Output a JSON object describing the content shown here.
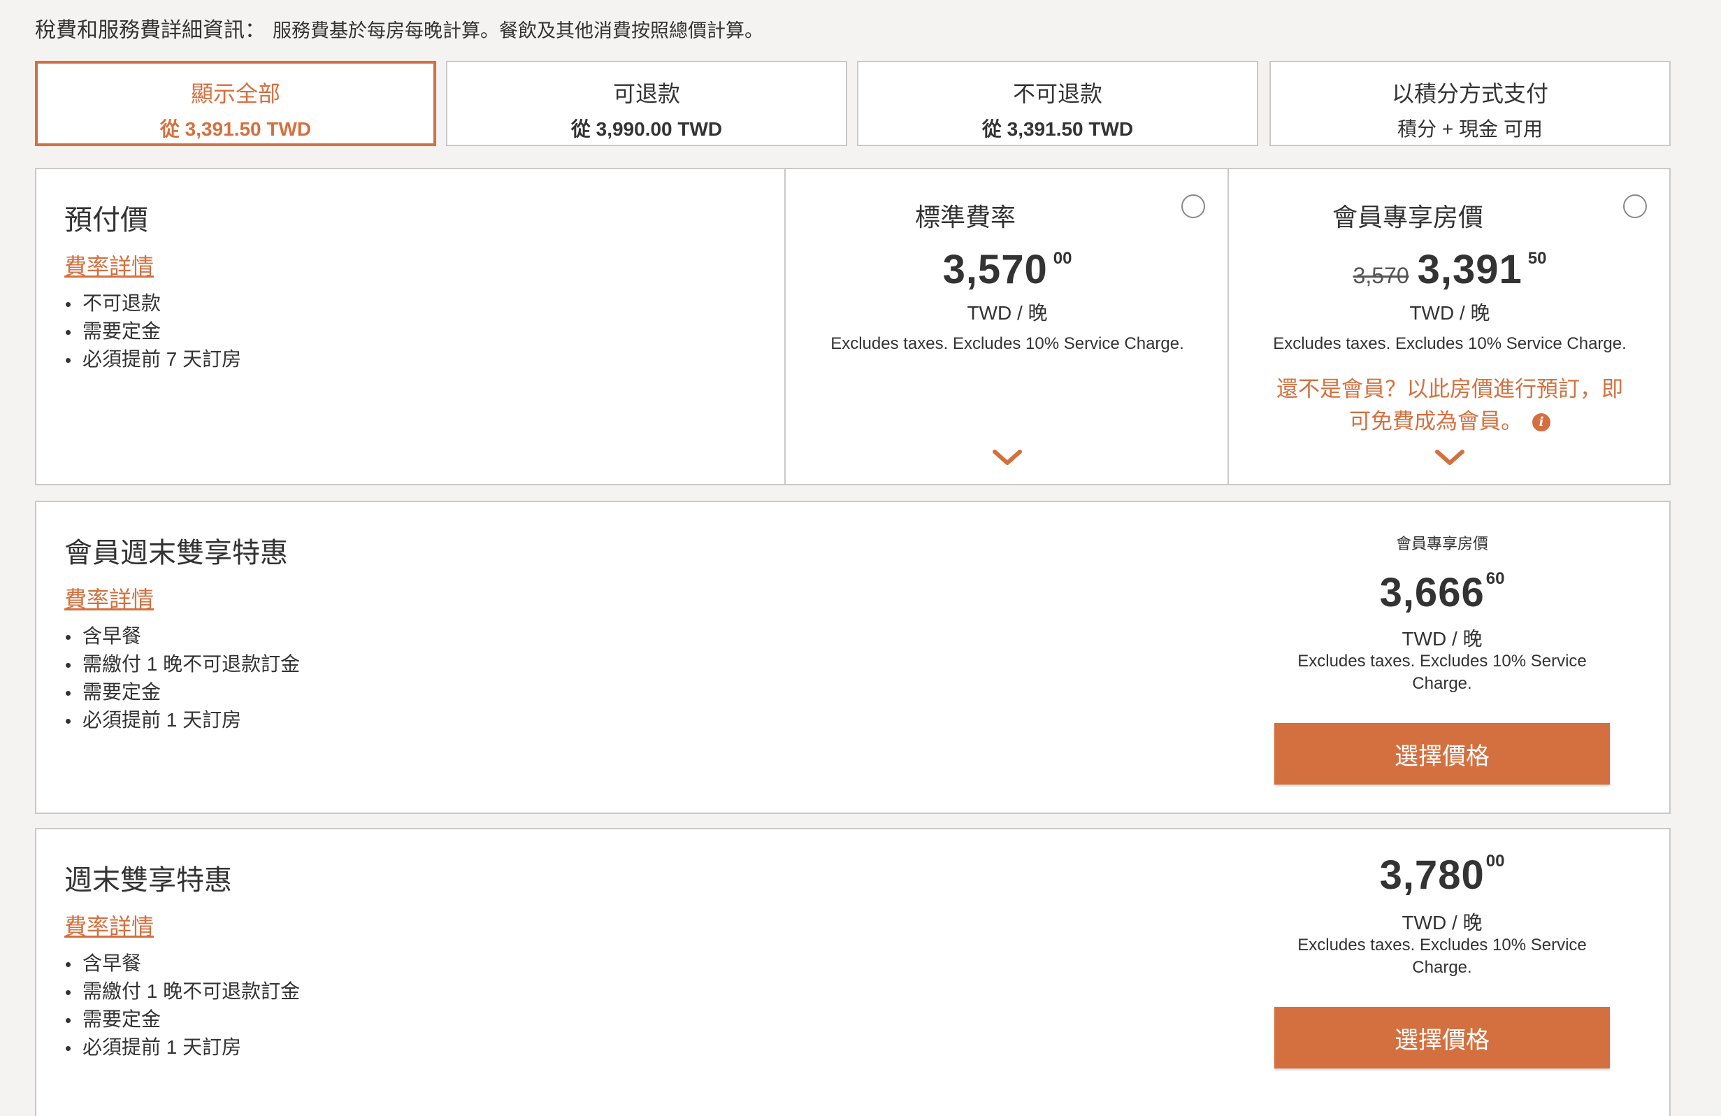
{
  "tax_note": {
    "title": "稅費和服務費詳細資訊：",
    "text": "服務費基於每房每晚計算。餐飲及其他消費按照總價計算。"
  },
  "filters": [
    {
      "label": "顯示全部",
      "sub": "從 3,391.50 TWD",
      "active": true
    },
    {
      "label": "可退款",
      "sub": "從 3,990.00 TWD",
      "active": false
    },
    {
      "label": "不可退款",
      "sub": "從 3,391.50 TWD",
      "active": false
    },
    {
      "label": "以積分方式支付",
      "sub": "積分 + 現金 可用",
      "active": false
    }
  ],
  "prepaid": {
    "title": "預付價",
    "rate_link": "費率詳情",
    "features": [
      "不可退款",
      "需要定金",
      "必須提前 7 天訂房"
    ],
    "standard": {
      "title": "標準費率",
      "price": "3,570",
      "decimals": "00",
      "unit": "TWD / 晚",
      "excludes": "Excludes taxes. Excludes 10% Service Charge."
    },
    "member": {
      "title": "會員專享房價",
      "old_price": "3,570",
      "price": "3,391",
      "decimals": "50",
      "unit": "TWD / 晚",
      "excludes": "Excludes taxes. Excludes 10% Service Charge.",
      "promo_line1": "還不是會員？以此房價進行預訂，即",
      "promo_line2": "可免費成為會員。"
    }
  },
  "offers": [
    {
      "title": "會員週末雙享特惠",
      "rate_link": "費率詳情",
      "features": [
        "含早餐",
        "需繳付 1 晚不可退款訂金",
        "需要定金",
        "必須提前 1 天訂房"
      ],
      "label": "會員專享房價",
      "price": "3,666",
      "decimals": "60",
      "unit": "TWD / 晚",
      "excludes_line1": "Excludes taxes. Excludes 10% Service",
      "excludes_line2": "Charge.",
      "button": "選擇價格"
    },
    {
      "title": "週末雙享特惠",
      "rate_link": "費率詳情",
      "features": [
        "含早餐",
        "需繳付 1 晚不可退款訂金",
        "需要定金",
        "必須提前 1 天訂房"
      ],
      "price": "3,780",
      "decimals": "00",
      "unit": "TWD / 晚",
      "excludes_line1": "Excludes taxes. Excludes 10% Service",
      "excludes_line2": "Charge.",
      "button": "選擇價格"
    }
  ],
  "colors": {
    "accent": "#d4703f",
    "border": "#c9c9c9",
    "background": "#f4f3f1"
  },
  "icons": {
    "radio": "radio-button-icon",
    "chevron": "chevron-down-icon",
    "info": "info-icon"
  }
}
